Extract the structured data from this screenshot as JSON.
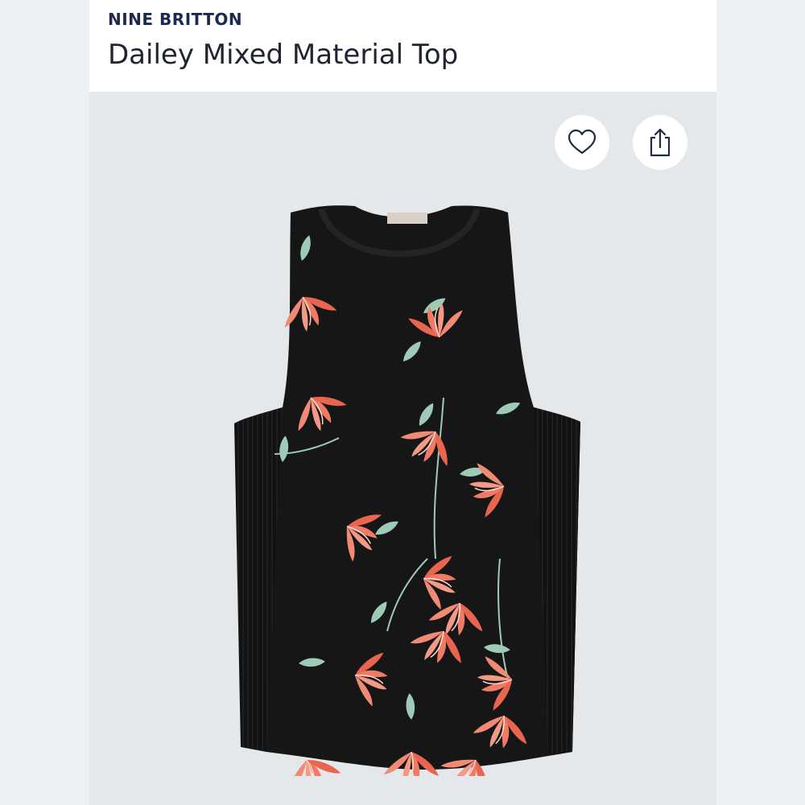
{
  "product": {
    "brand": "NINE BRITTON",
    "title": "Dailey Mixed Material Top"
  },
  "actions": {
    "favorite_icon": "heart-icon",
    "share_icon": "share-icon"
  },
  "image": {
    "subject": "black sleeveless tank top with coral floral print and ribbed side panels",
    "colors": {
      "garment": "#161616",
      "flower": "#ef7b66",
      "leaf": "#9ecbb8"
    }
  }
}
